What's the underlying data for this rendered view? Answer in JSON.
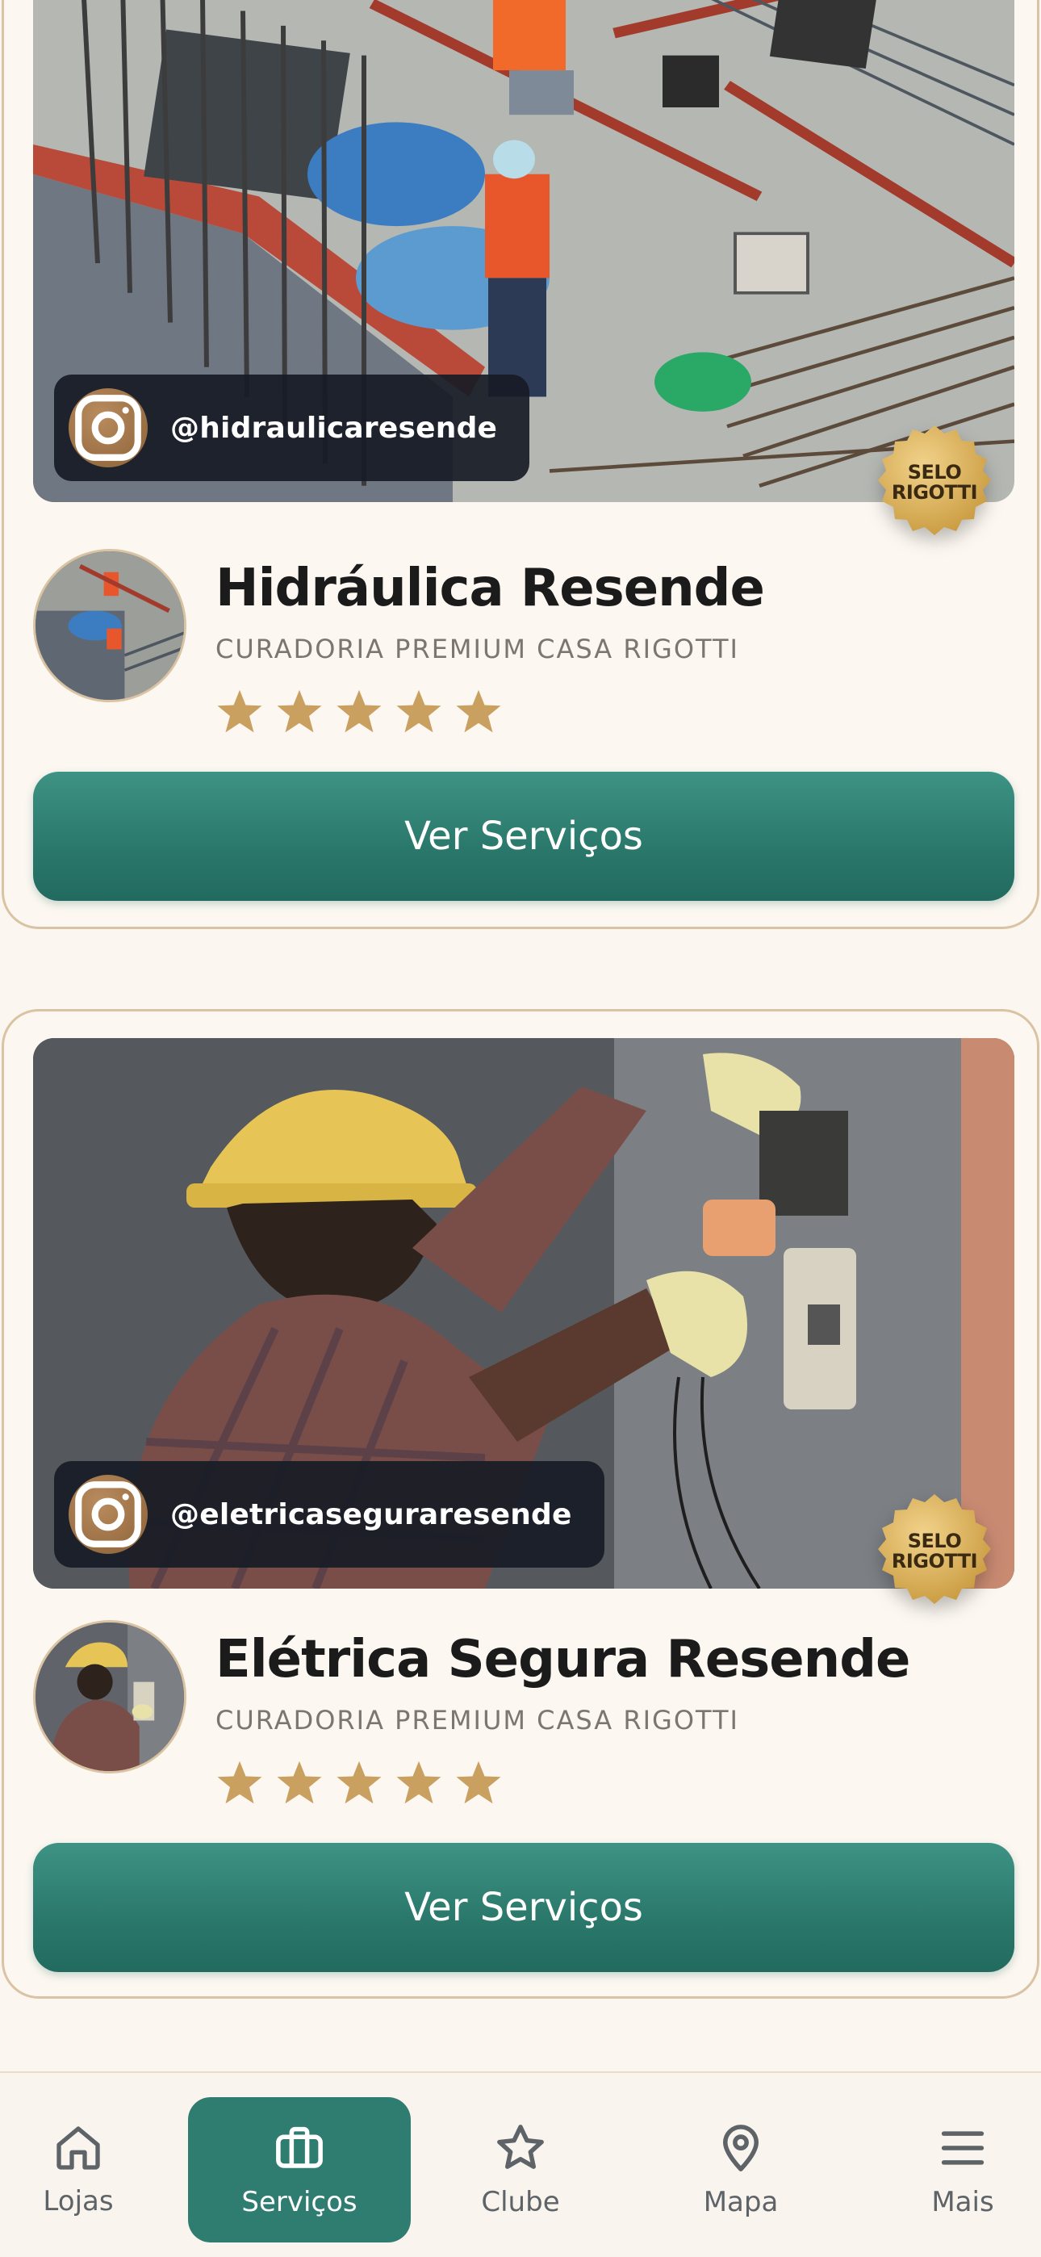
{
  "listings": [
    {
      "instagram_handle": "@hidraulicaresende",
      "seal_line1": "SELO",
      "seal_line2": "RIGOTTI",
      "name": "Hidráulica Resende",
      "subtitle": "CURADORIA PREMIUM CASA RIGOTTI",
      "rating": 5,
      "button_label": "Ver Serviços"
    },
    {
      "instagram_handle": "@eletricaseguraresende",
      "seal_line1": "SELO",
      "seal_line2": "RIGOTTI",
      "name": "Elétrica Segura Resende",
      "subtitle": "CURADORIA PREMIUM CASA RIGOTTI",
      "rating": 5,
      "button_label": "Ver Serviços"
    }
  ],
  "bottom_nav": {
    "items": [
      {
        "label": "Lojas",
        "icon": "home-icon",
        "active": false
      },
      {
        "label": "Serviços",
        "icon": "briefcase-icon",
        "active": true
      },
      {
        "label": "Clube",
        "icon": "star-icon",
        "active": false
      },
      {
        "label": "Mapa",
        "icon": "map-pin-icon",
        "active": false
      },
      {
        "label": "Mais",
        "icon": "menu-icon",
        "active": false
      }
    ]
  },
  "colors": {
    "background": "#FBF6F0",
    "accent_teal": "#2E7D70",
    "gold": "#C9A05F",
    "card_border": "#D9C3A3"
  }
}
